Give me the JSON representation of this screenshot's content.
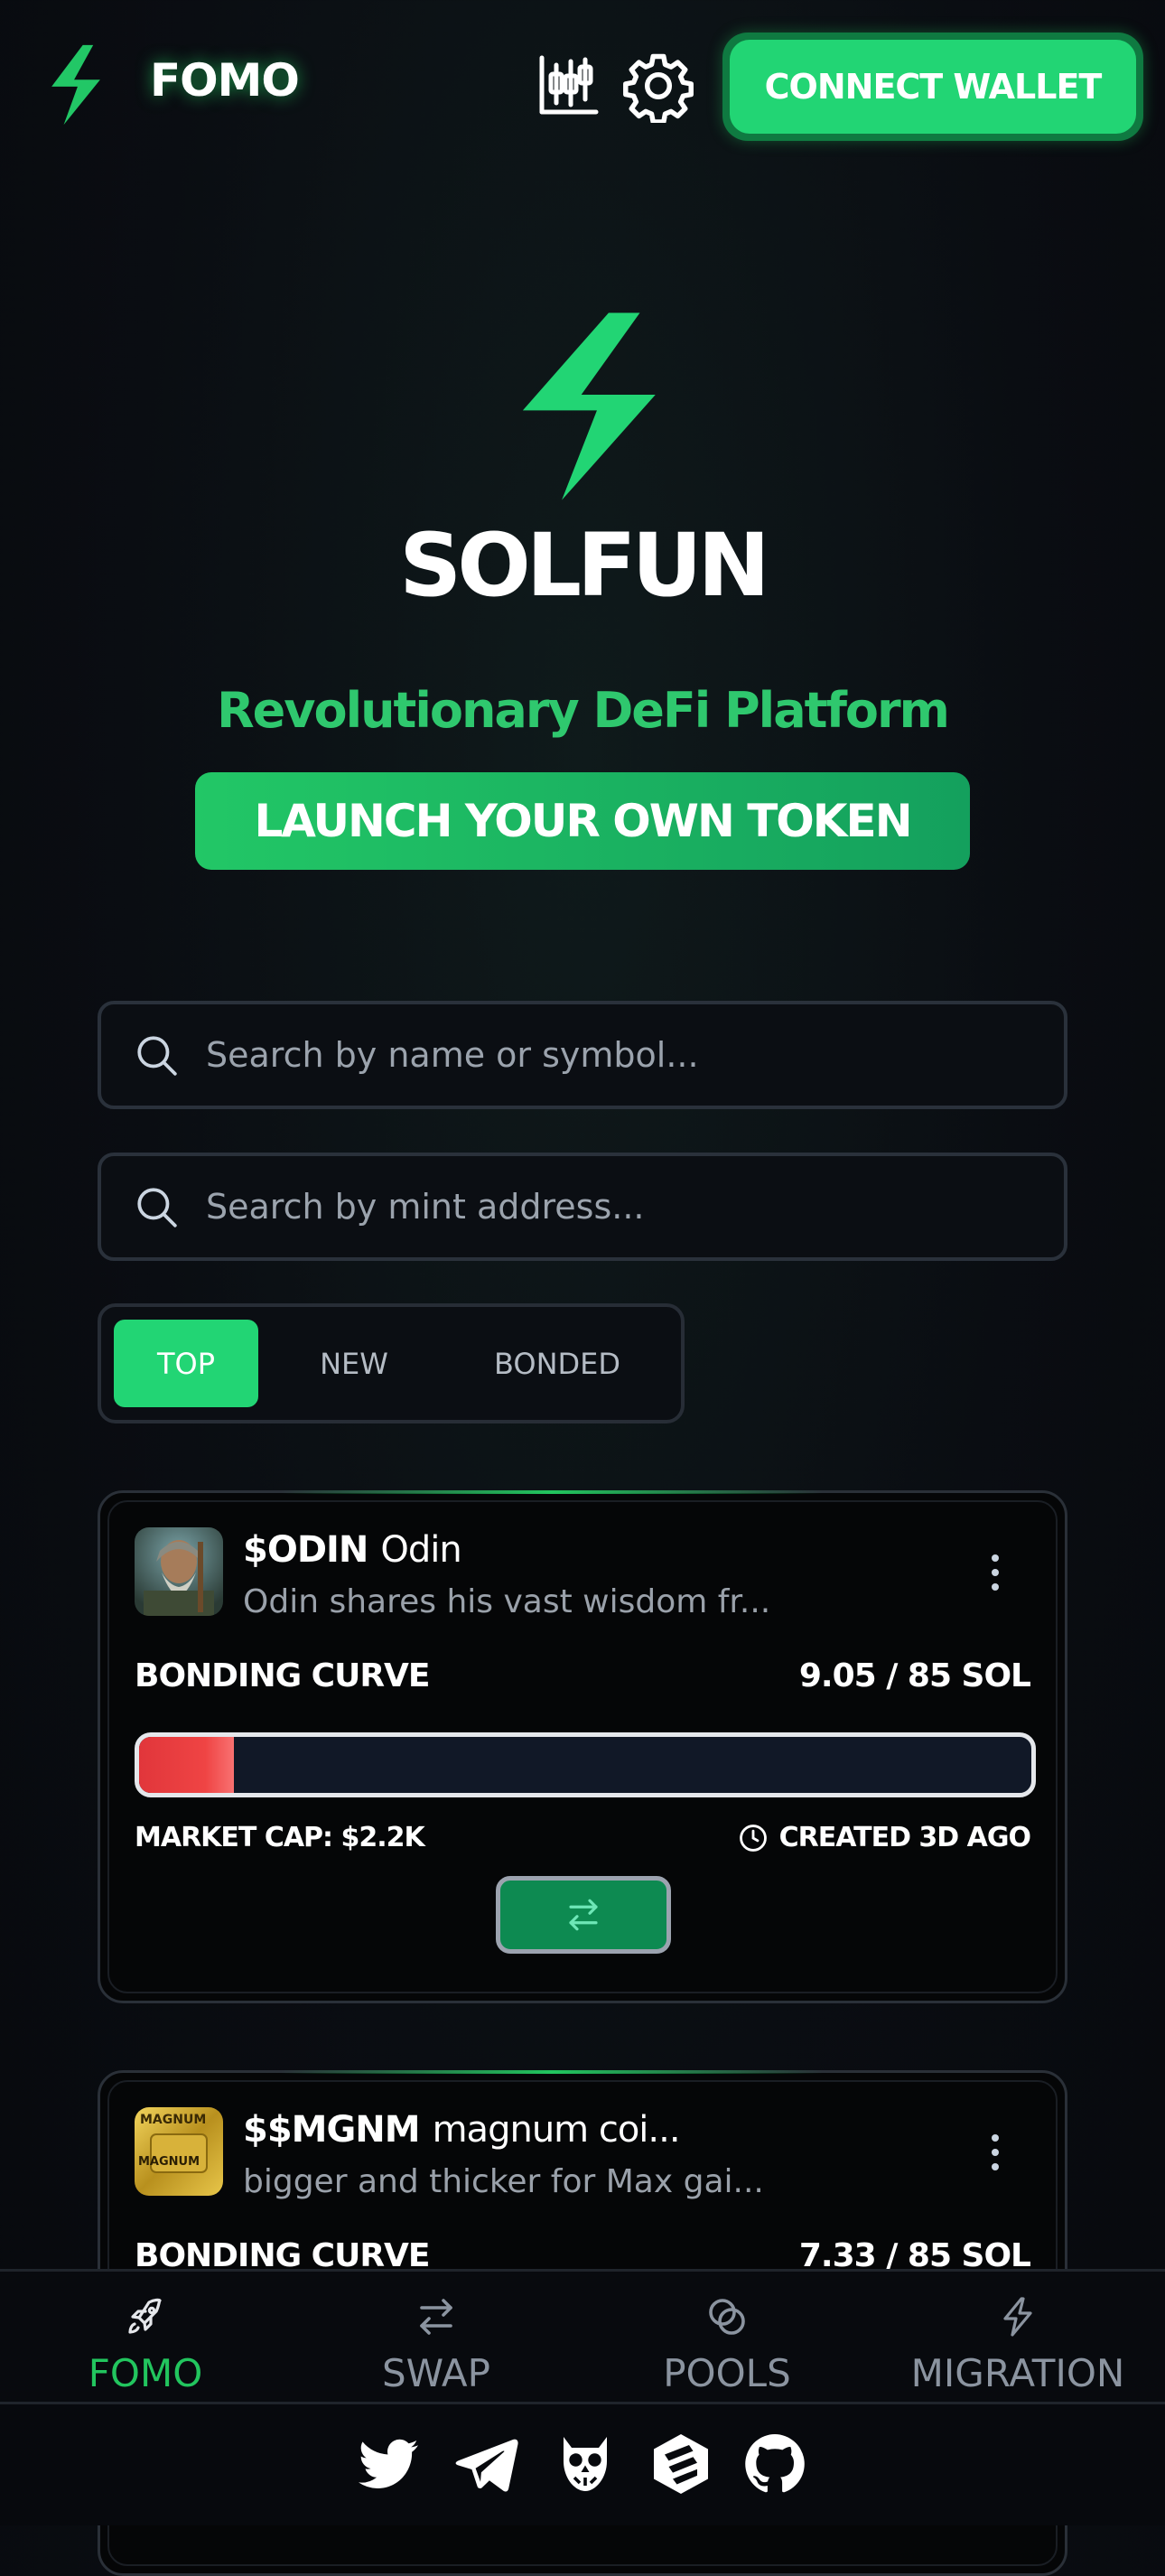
{
  "header": {
    "brand": "FOMO",
    "connect_label": "CONNECT WALLET"
  },
  "hero": {
    "title": "SOLFUN",
    "tagline": "Revolutionary DeFi Platform",
    "launch_label": "LAUNCH YOUR OWN TOKEN"
  },
  "search": {
    "name_placeholder": "Search by name or symbol...",
    "mint_placeholder": "Search by mint address..."
  },
  "tabs": [
    {
      "label": "TOP",
      "active": true
    },
    {
      "label": "NEW",
      "active": false
    },
    {
      "label": "BONDED",
      "active": false
    }
  ],
  "tokens": [
    {
      "symbol": "$ODIN",
      "name": "Odin",
      "description": "Odin shares his vast wisdom fr...",
      "bonding_label": "BONDING CURVE",
      "bonding_value": "9.05 / 85 SOL",
      "progress": 0.106,
      "market_cap": "MARKET CAP: $2.2K",
      "created": "CREATED 3D AGO"
    },
    {
      "symbol": "$$MGNM",
      "name": "magnum coi...",
      "description": "bigger and thicker for Max gai...",
      "bonding_label": "BONDING CURVE",
      "bonding_value": "7.33 / 85 SOL",
      "avatar_text": "MAGNUM",
      "avatar_text_2": "MAGNUM"
    }
  ],
  "nav": [
    {
      "label": "FOMO",
      "icon": "rocket-icon",
      "active": true
    },
    {
      "label": "SWAP",
      "icon": "swap-arrows-icon",
      "active": false
    },
    {
      "label": "POOLS",
      "icon": "pools-icon",
      "active": false
    },
    {
      "label": "MIGRATION",
      "icon": "bolt-icon",
      "active": false
    }
  ],
  "footer_icons": [
    "twitter-icon",
    "telegram-icon",
    "owl-icon",
    "dex-icon",
    "github-icon"
  ],
  "colors": {
    "accent": "#22d574",
    "tagline": "#2fc86e",
    "progress_fill": "#ef4444",
    "background": "#0a0d12"
  }
}
